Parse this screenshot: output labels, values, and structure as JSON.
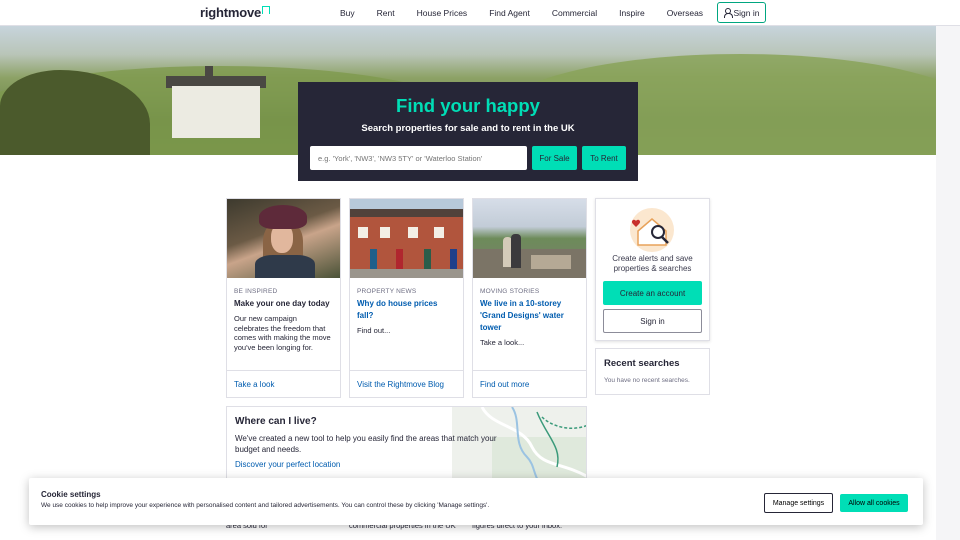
{
  "header": {
    "logo": "rightmove",
    "nav": [
      "Buy",
      "Rent",
      "House Prices",
      "Find Agent",
      "Commercial",
      "Inspire",
      "Overseas"
    ],
    "sign_in": "Sign in"
  },
  "hero": {
    "title": "Find your happy",
    "subtitle": "Search properties for sale and to rent in the UK",
    "search_placeholder": "e.g. 'York', 'NW3', 'NW3 5TY' or 'Waterloo Station'",
    "for_sale": "For Sale",
    "to_rent": "To Rent"
  },
  "cards": [
    {
      "tag": "BE INSPIRED",
      "title": "Make your one day today",
      "desc": "Our new campaign celebrates the freedom that comes with making the move you've been longing for.",
      "link": "Take a look"
    },
    {
      "tag": "PROPERTY NEWS",
      "title": "Why do house prices fall?",
      "desc": "Find out...",
      "link": "Visit the Rightmove Blog"
    },
    {
      "tag": "MOVING STORIES",
      "title": "We live in a 10-storey 'Grand Designs' water tower",
      "desc": "Take a look...",
      "link": "Find out more"
    }
  ],
  "side": {
    "text": "Create alerts and save properties & searches",
    "create": "Create an account",
    "sign_in": "Sign in"
  },
  "recent": {
    "title": "Recent searches",
    "empty": "You have no recent searches."
  },
  "where": {
    "title": "Where can I live?",
    "text": "We've created a new tool to help you easily find the areas that match your budget and needs.",
    "link": "Discover your perfect location"
  },
  "under": [
    "area sold for",
    "commercial properties in the UK",
    "figures direct to your inbox."
  ],
  "cookie": {
    "title": "Cookie settings",
    "text": "We use cookies to help improve your experience with personalised content and tailored advertisements. You can control these by clicking 'Manage settings'.",
    "manage": "Manage settings",
    "allow": "Allow all cookies"
  }
}
